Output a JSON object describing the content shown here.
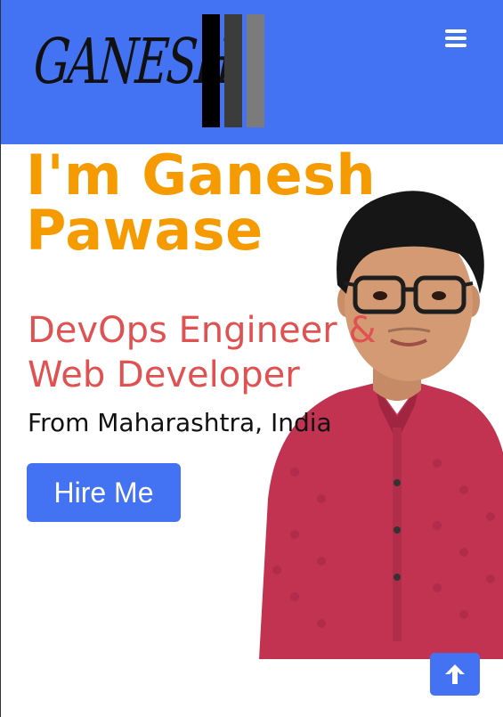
{
  "navbar": {
    "logo_text": "GANESH",
    "menu_icon": "hamburger-menu-icon"
  },
  "hero": {
    "title": "I'm Ganesh Pawase",
    "subtitle": "DevOps Engineer & Web Developer",
    "location": "From Maharashtra, India",
    "hire_button_label": "Hire Me"
  },
  "back_to_top": {
    "icon": "arrow-up-icon"
  },
  "colors": {
    "primary": "#4373f2",
    "title": "#f59b00",
    "subtitle": "#e05252",
    "shirt": "#c23352"
  }
}
